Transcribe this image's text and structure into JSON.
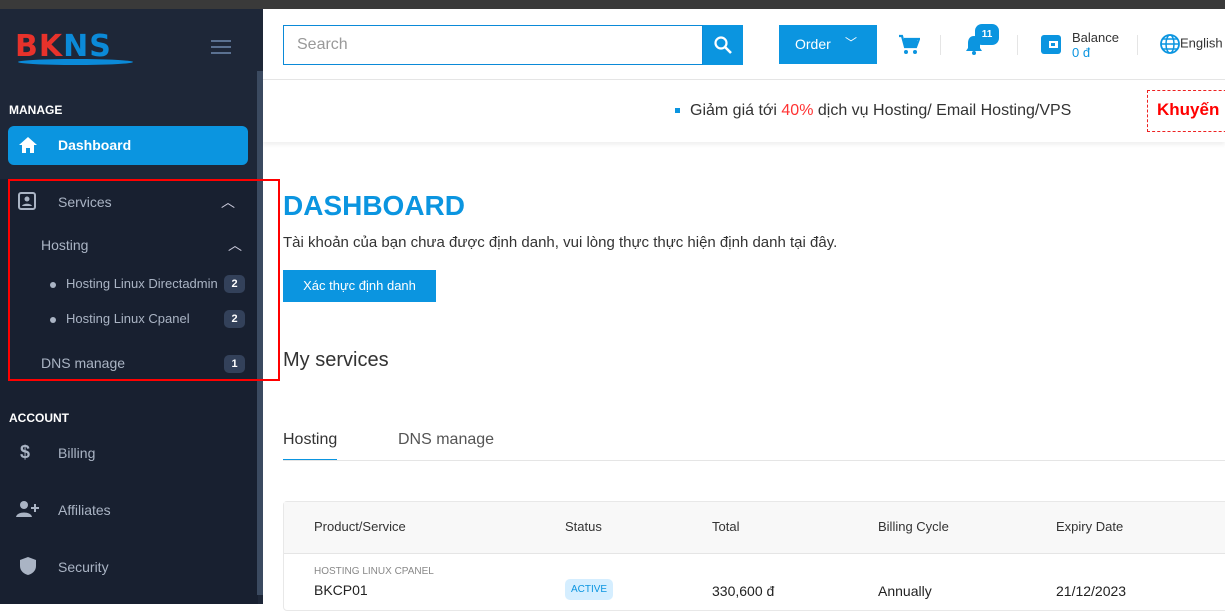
{
  "logo": {
    "text_red": "BK",
    "text_blue": "NS"
  },
  "sidebar": {
    "manage_label": "MANAGE",
    "dashboard": "Dashboard",
    "services": "Services",
    "hosting": "Hosting",
    "hosting_items": [
      {
        "label": "Hosting Linux Directadmin",
        "count": "2"
      },
      {
        "label": "Hosting Linux Cpanel",
        "count": "2"
      }
    ],
    "dns": {
      "label": "DNS manage",
      "count": "1"
    },
    "account_label": "ACCOUNT",
    "billing": "Billing",
    "affiliates": "Affiliates",
    "security": "Security"
  },
  "header": {
    "search_placeholder": "Search",
    "order": "Order",
    "notifications": "11",
    "balance_label": "Balance",
    "balance_value": "0 đ",
    "language": "English"
  },
  "promo": {
    "prefix": "Giảm giá tới ",
    "highlight": "40%",
    "suffix": " dịch vụ Hosting/ Email Hosting/VPS",
    "tag": "Khuyến"
  },
  "main": {
    "title": "DASHBOARD",
    "notice": "Tài khoản của bạn chưa được định danh, vui lòng thực thực hiện định danh tại đây.",
    "verify_button": "Xác thực định danh",
    "my_services": "My services",
    "tabs": [
      "Hosting",
      "DNS manage"
    ],
    "table": {
      "headers": [
        "Product/Service",
        "Status",
        "Total",
        "Billing Cycle",
        "Expiry Date"
      ],
      "rows": [
        {
          "category": "HOSTING LINUX CPANEL",
          "name": "BKCP01",
          "status": "ACTIVE",
          "total": "330,600 đ",
          "cycle": "Annually",
          "expiry": "21/12/2023"
        }
      ]
    }
  },
  "colors": {
    "accent": "#0b95e0",
    "sidebar": "#1e2738",
    "promo_red": "#f00"
  }
}
